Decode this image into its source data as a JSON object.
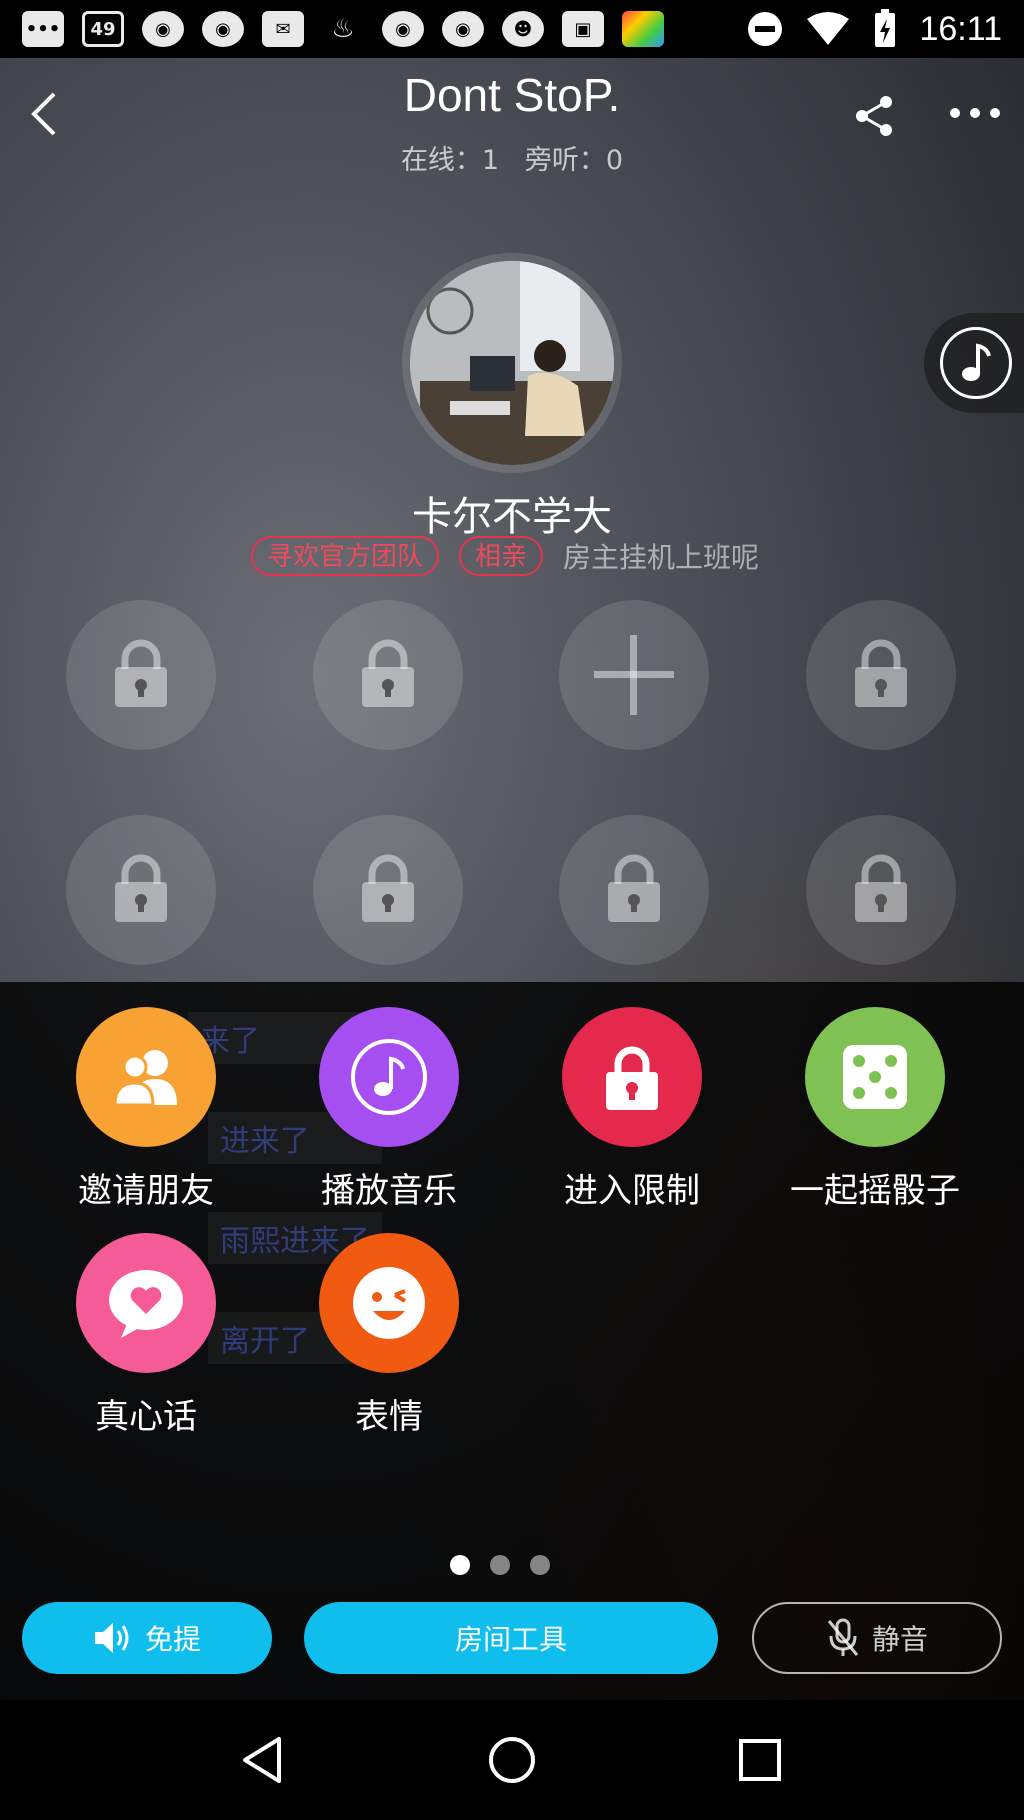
{
  "status_bar": {
    "notification_count": "49",
    "time": "16:11",
    "icons": [
      "more-icon",
      "notification-count-icon",
      "weibo-icon",
      "weibo-icon",
      "mail-icon",
      "cup-icon",
      "weibo-icon",
      "weibo-icon",
      "raccoon-icon",
      "image-icon",
      "app-icon",
      "dnd-icon",
      "wifi-icon",
      "battery-charging-icon"
    ]
  },
  "header": {
    "title": "Dont StoP.",
    "online_label": "在线：1",
    "listeners_label": "旁听：0"
  },
  "host": {
    "name": "卡尔不学大",
    "tags": [
      "寻欢官方团队",
      "相亲"
    ],
    "note": "房主挂机上班呢"
  },
  "seats": [
    {
      "state": "locked"
    },
    {
      "state": "locked"
    },
    {
      "state": "add"
    },
    {
      "state": "locked"
    },
    {
      "state": "locked"
    },
    {
      "state": "locked"
    },
    {
      "state": "locked"
    },
    {
      "state": "locked"
    }
  ],
  "chat_ghost": [
    "来了",
    "进来了",
    "雨熙进来了",
    "离开了"
  ],
  "tools": [
    {
      "label": "邀请朋友",
      "color": "#f7a233",
      "icon": "friends-icon"
    },
    {
      "label": "播放音乐",
      "color": "#a54ff0",
      "icon": "music-icon"
    },
    {
      "label": "进入限制",
      "color": "#e4294c",
      "icon": "lock-icon"
    },
    {
      "label": "一起摇骰子",
      "color": "#7fc152",
      "icon": "dice-icon"
    },
    {
      "label": "真心话",
      "color": "#f55b96",
      "icon": "heart-chat-icon"
    },
    {
      "label": "表情",
      "color": "#f05a11",
      "icon": "emoji-icon"
    }
  ],
  "page_indicator": {
    "pages": 3,
    "current": 1
  },
  "bottom_bar": {
    "speaker_label": "免提",
    "room_tools_label": "房间工具",
    "mute_label": "静音"
  },
  "colors": {
    "accent": "#0fbeed",
    "tag_red": "#e8344b"
  }
}
